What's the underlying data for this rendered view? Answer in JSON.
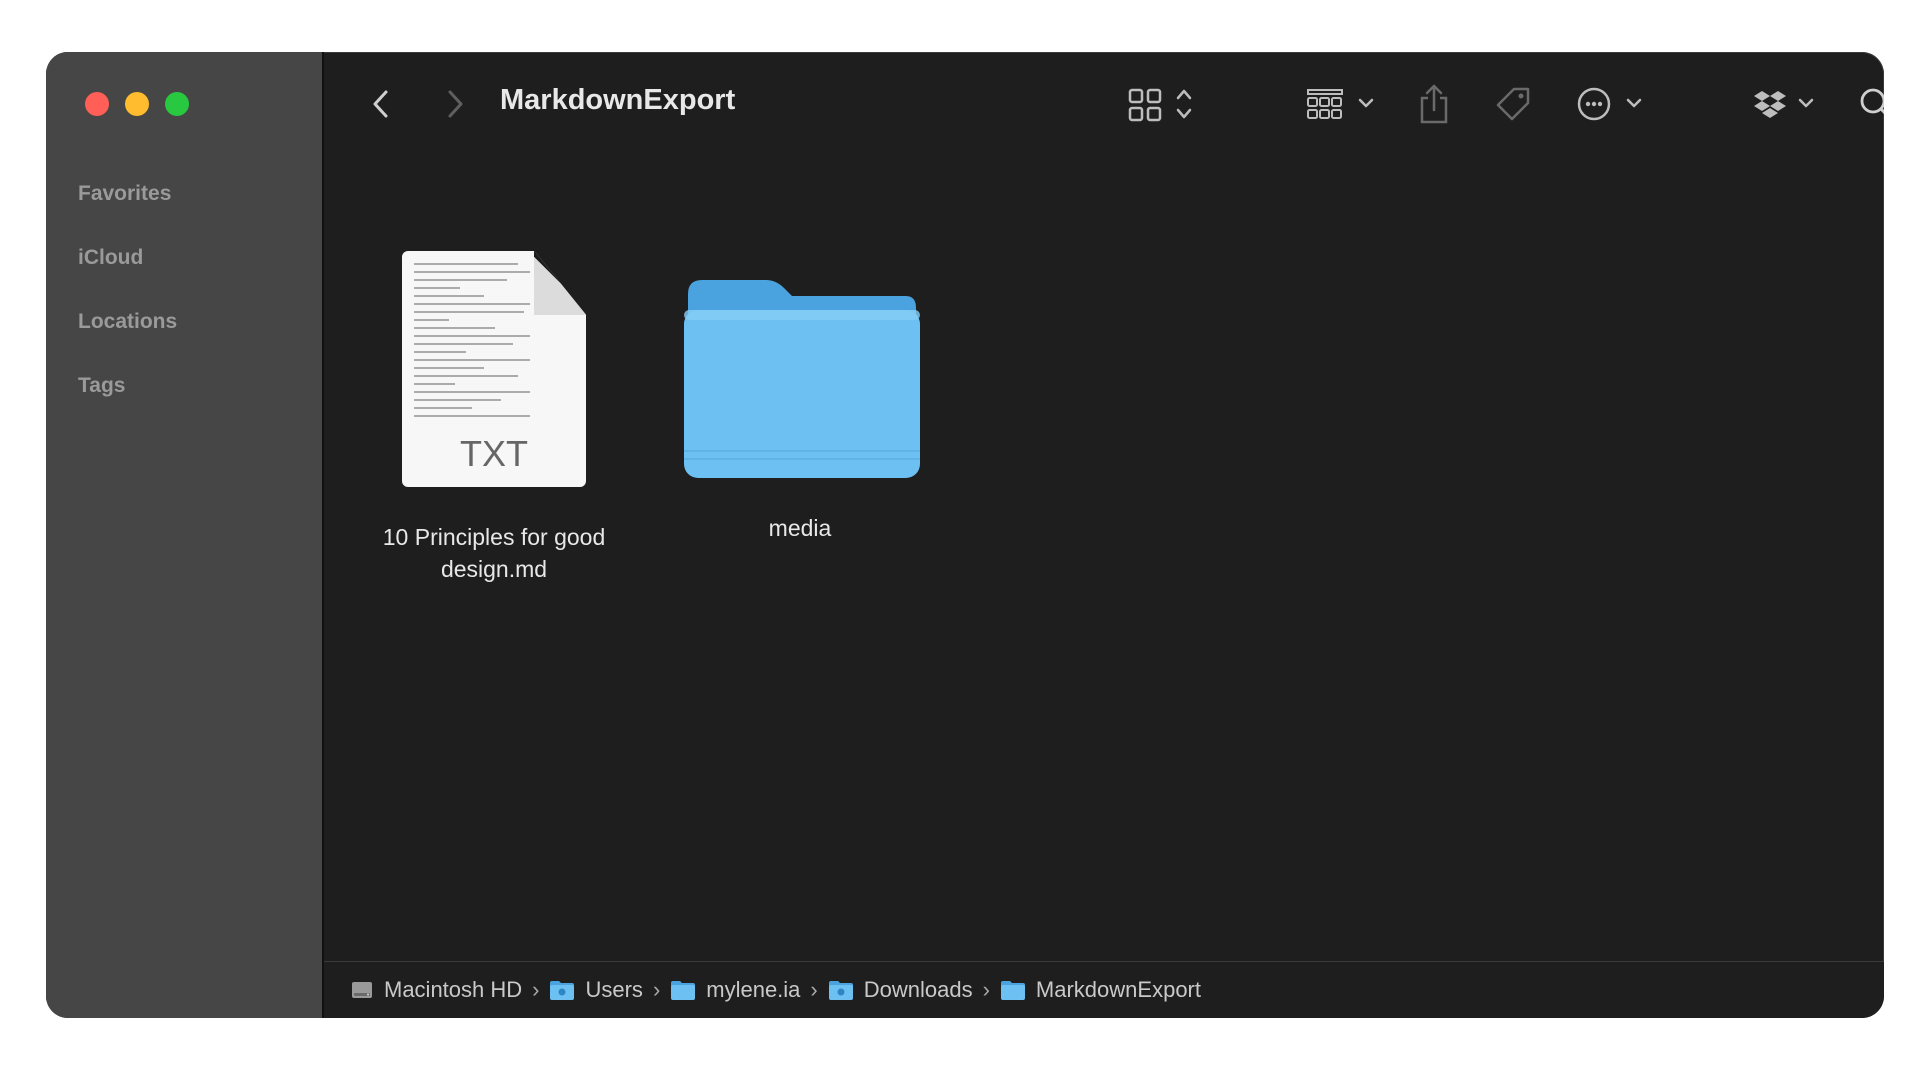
{
  "window": {
    "title": "MarkdownExport"
  },
  "sidebar": {
    "sections": [
      {
        "label": "Favorites"
      },
      {
        "label": "iCloud"
      },
      {
        "label": "Locations"
      },
      {
        "label": "Tags"
      }
    ]
  },
  "toolbar": {
    "icons": [
      "chevron-left-icon",
      "chevron-right-icon",
      "grid-view-icon",
      "group-icon",
      "share-icon",
      "tag-icon",
      "more-icon",
      "dropbox-icon",
      "search-icon"
    ]
  },
  "files": [
    {
      "name": "10 Principles for good design.md",
      "type": "document",
      "badge": "TXT"
    },
    {
      "name": "media",
      "type": "folder"
    }
  ],
  "pathbar": {
    "crumbs": [
      {
        "label": "Macintosh HD",
        "icon": "disk-icon"
      },
      {
        "label": "Users",
        "icon": "folder-icon"
      },
      {
        "label": "mylene.ia",
        "icon": "folder-icon"
      },
      {
        "label": "Downloads",
        "icon": "folder-icon"
      },
      {
        "label": "MarkdownExport",
        "icon": "folder-icon"
      }
    ]
  },
  "colors": {
    "folder": "#6cc0f2",
    "close": "#ff5f57",
    "minimize": "#febc2e",
    "maximize": "#28c840"
  }
}
